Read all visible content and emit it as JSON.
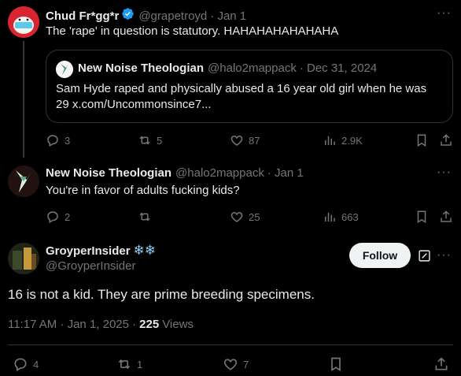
{
  "tweet1": {
    "display_name": "Chud Fr*gg*r",
    "handle": "@grapetroyd",
    "date": "· Jan 1",
    "text": "The 'rape' in question is statutory. HAHAHAHAHAHAHA",
    "quote": {
      "display_name": "New Noise Theologian",
      "handle": "@halo2mappack",
      "date": "· Dec 31, 2024",
      "text": "Sam Hyde raped and physically abused a 16 year old girl when he was 29 x.com/Uncommonsince7..."
    },
    "replies": "3",
    "reposts": "5",
    "likes": "87",
    "views": "2.9K"
  },
  "tweet2": {
    "display_name": "New Noise Theologian",
    "handle": "@halo2mappack",
    "date": "· Jan 1",
    "text": "You're in favor of adults fucking kids?",
    "replies": "2",
    "reposts": "",
    "likes": "25",
    "views": "663"
  },
  "tweet3": {
    "display_name": "GroyperInsider",
    "name_emoji": "❄❄",
    "handle": "@GroyperInsider",
    "follow_label": "Follow",
    "text": "16 is not a kid. They are prime breeding specimens.",
    "time": "11:17 AM · Jan 1, 2025 ·",
    "views_count": "225",
    "views_label": "Views",
    "replies": "4",
    "reposts": "1",
    "likes": "7"
  },
  "more_label": "···",
  "colors": {
    "accent": "#1d9bf0",
    "muted": "#71767b",
    "border": "#2f3336"
  }
}
